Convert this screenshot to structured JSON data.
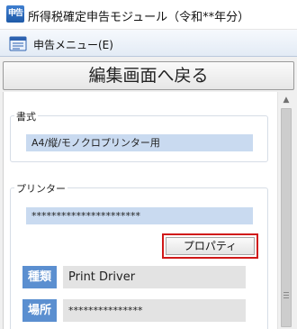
{
  "window": {
    "app_icon_text": "申告",
    "title": "所得税確定申告モジュール（令和**年分）"
  },
  "menu": {
    "icon": "declaration-menu-icon",
    "label": "申告メニュー(E)"
  },
  "back_button_label": "編集画面へ戻る",
  "format_group": {
    "label": "書式",
    "value": "A4/縦/モノクロプリンター用"
  },
  "printer_group": {
    "label": "プリンター",
    "printer_name": "**********************",
    "properties_button": "プロパティ",
    "type_label": "種類",
    "type_value": "Print Driver",
    "location_label": "場所",
    "location_value": "***************"
  },
  "colors": {
    "field_blue": "#c9daf0",
    "tag_blue": "#5b8fd0",
    "highlight_red": "#d01818"
  }
}
